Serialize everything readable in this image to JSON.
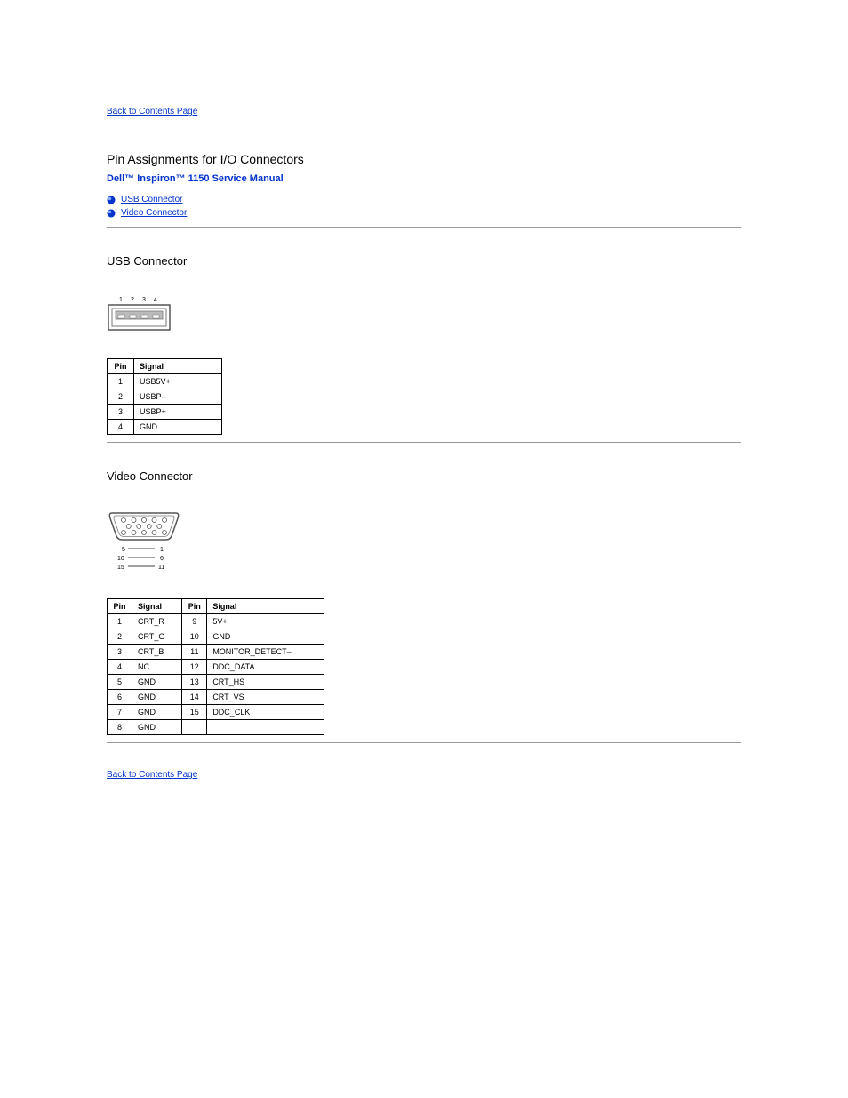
{
  "back_link_top": "Back to Contents Page",
  "page_title": "Pin Assignments for I/O Connectors",
  "manual_title": "Dell™ Inspiron™ 1150 Service Manual",
  "toc": [
    {
      "label": "USB Connector"
    },
    {
      "label": "Video Connector"
    }
  ],
  "usb_section": {
    "title": "USB Connector",
    "table_headers": [
      "Pin",
      "Signal"
    ],
    "rows": [
      [
        "1",
        "USB5V+"
      ],
      [
        "2",
        "USBP–"
      ],
      [
        "3",
        "USBP+"
      ],
      [
        "4",
        "GND"
      ]
    ]
  },
  "video_section": {
    "title": "Video Connector",
    "table_headers": [
      "Pin",
      "Signal",
      "Pin",
      "Signal"
    ],
    "rows": [
      [
        "1",
        "CRT_R",
        "9",
        "5V+"
      ],
      [
        "2",
        "CRT_G",
        "10",
        "GND"
      ],
      [
        "3",
        "CRT_B",
        "11",
        "MONITOR_DETECT–"
      ],
      [
        "4",
        "NC",
        "12",
        "DDC_DATA"
      ],
      [
        "5",
        "GND",
        "13",
        "CRT_HS"
      ],
      [
        "6",
        "GND",
        "14",
        "CRT_VS"
      ],
      [
        "7",
        "GND",
        "15",
        "DDC_CLK"
      ],
      [
        "8",
        "GND",
        "",
        ""
      ]
    ]
  },
  "back_link_bottom": "Back to Contents Page"
}
